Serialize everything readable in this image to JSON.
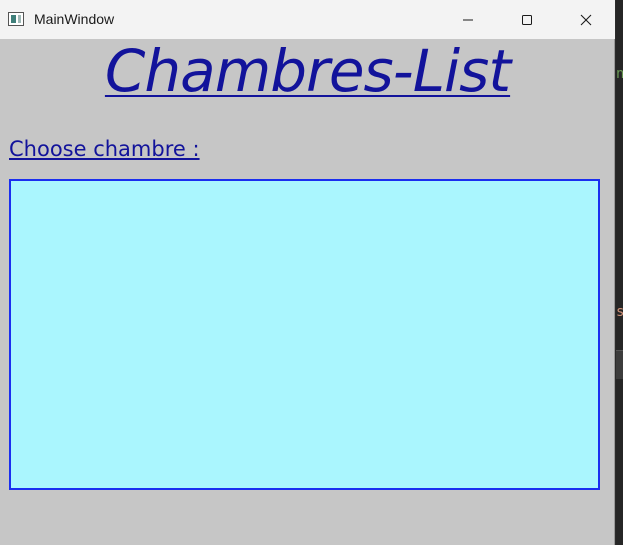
{
  "window": {
    "title": "MainWindow"
  },
  "header": {
    "title": "Chambres-List"
  },
  "form": {
    "choose_label": "Choose chambre :"
  },
  "list": {
    "items": []
  },
  "colors": {
    "accent_text": "#12139b",
    "list_background": "#aaf6fe",
    "list_border": "#1a2ef0",
    "window_background": "#c6c6c6"
  }
}
